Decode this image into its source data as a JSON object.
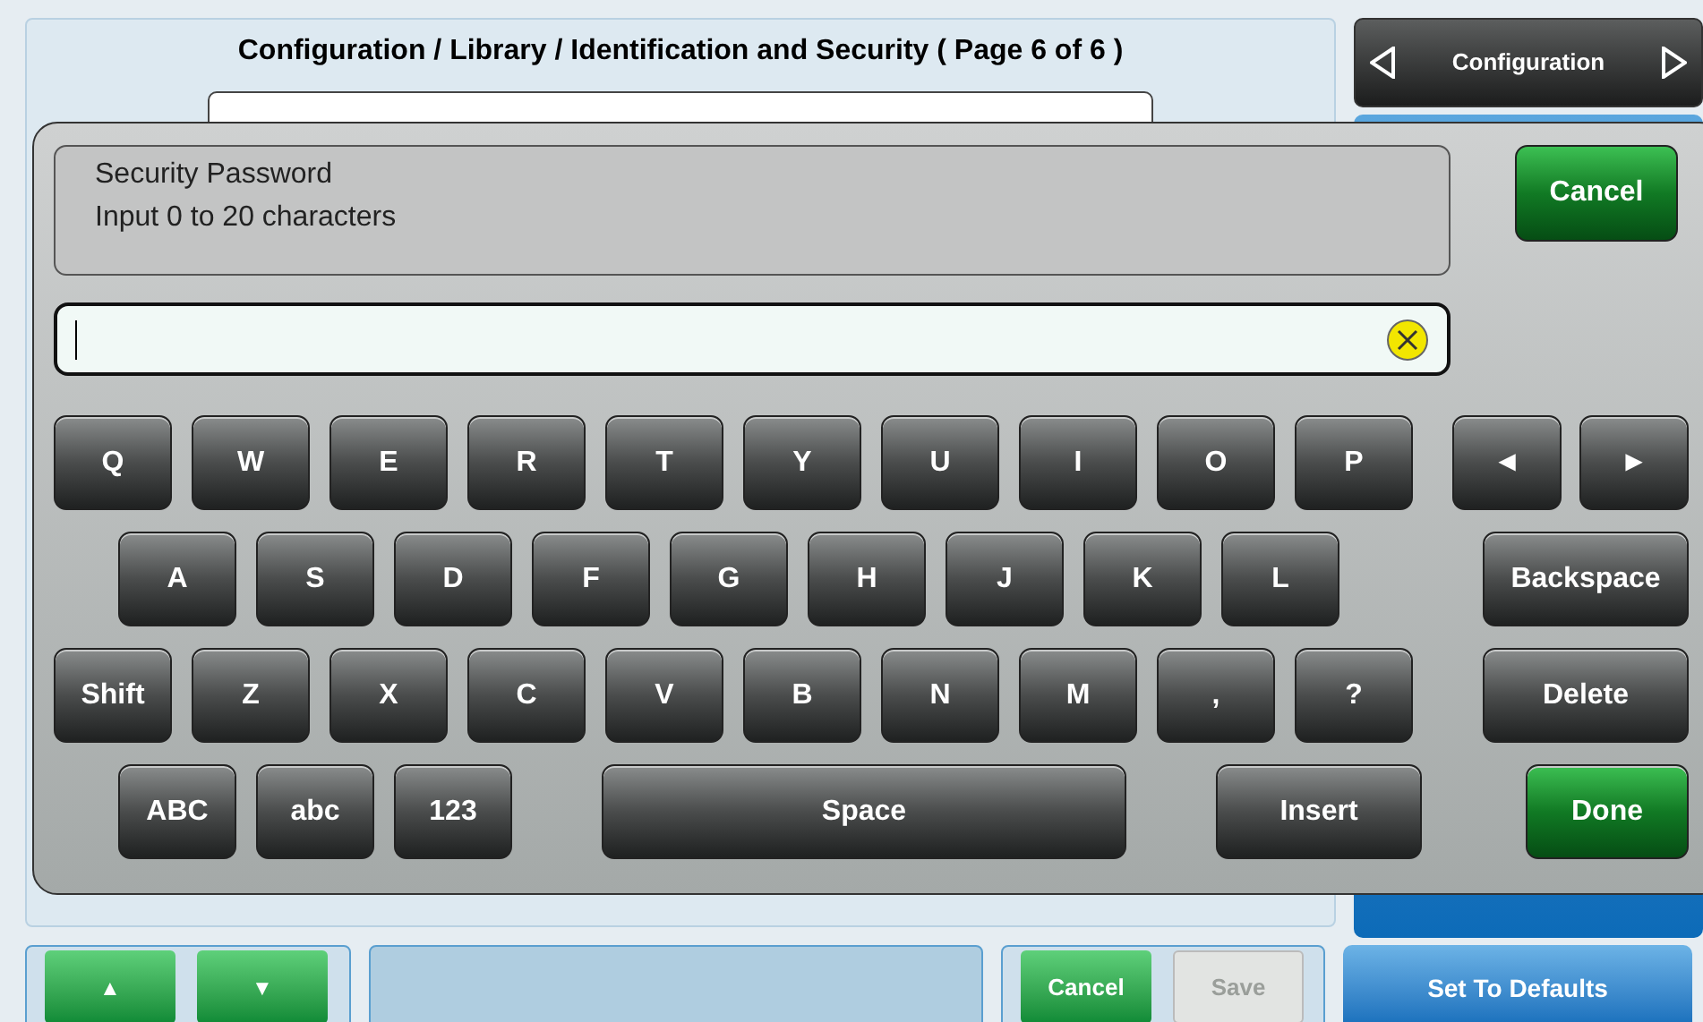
{
  "header": {
    "title": "Configuration / Library / Identification and Security ( Page 6 of 6 )"
  },
  "nav": {
    "label": "Configuration"
  },
  "side_buttons": [
    {
      "label": "Set To Defaults"
    }
  ],
  "bottom": {
    "up": "▲",
    "down": "▼",
    "buttons": [
      {
        "label": "Cancel",
        "disabled": false
      },
      {
        "label": "Save",
        "disabled": true
      }
    ]
  },
  "dialog": {
    "prompt": "Security Password",
    "hint": "Input 0 to 20 characters",
    "cancel": "Cancel",
    "rows": [
      {
        "left": [
          {
            "label": "Q",
            "kind": "key"
          },
          {
            "label": "W",
            "kind": "key"
          },
          {
            "label": "E",
            "kind": "key"
          },
          {
            "label": "R",
            "kind": "key"
          },
          {
            "label": "T",
            "kind": "key"
          },
          {
            "label": "Y",
            "kind": "key"
          },
          {
            "label": "U",
            "kind": "key"
          },
          {
            "label": "I",
            "kind": "key"
          },
          {
            "label": "O",
            "kind": "key"
          },
          {
            "label": "P",
            "kind": "key"
          }
        ],
        "right": [
          {
            "label": "◄",
            "kind": "arrow"
          },
          {
            "label": "►",
            "kind": "arrow"
          }
        ]
      },
      {
        "left": [
          {
            "label": "A",
            "kind": "key"
          },
          {
            "label": "S",
            "kind": "key"
          },
          {
            "label": "D",
            "kind": "key"
          },
          {
            "label": "F",
            "kind": "key"
          },
          {
            "label": "G",
            "kind": "key"
          },
          {
            "label": "H",
            "kind": "key"
          },
          {
            "label": "J",
            "kind": "key"
          },
          {
            "label": "K",
            "kind": "key"
          },
          {
            "label": "L",
            "kind": "key"
          }
        ],
        "right": [
          {
            "label": "Backspace",
            "kind": "wide"
          }
        ]
      },
      {
        "left": [
          {
            "label": "Shift",
            "kind": "key"
          },
          {
            "label": "Z",
            "kind": "key"
          },
          {
            "label": "X",
            "kind": "key"
          },
          {
            "label": "C",
            "kind": "key"
          },
          {
            "label": "V",
            "kind": "key"
          },
          {
            "label": "B",
            "kind": "key"
          },
          {
            "label": "N",
            "kind": "key"
          },
          {
            "label": "M",
            "kind": "key"
          },
          {
            "label": ",",
            "kind": "key"
          },
          {
            "label": "?",
            "kind": "key"
          }
        ],
        "right": [
          {
            "label": "Delete",
            "kind": "wide"
          }
        ]
      },
      {
        "left": [
          {
            "label": "ABC",
            "kind": "key"
          },
          {
            "label": "abc",
            "kind": "key"
          },
          {
            "label": "123",
            "kind": "key"
          },
          {
            "label": "Space",
            "kind": "space"
          },
          {
            "label": "Insert",
            "kind": "wide"
          }
        ],
        "right": [
          {
            "label": "Done",
            "kind": "green"
          }
        ]
      }
    ]
  }
}
